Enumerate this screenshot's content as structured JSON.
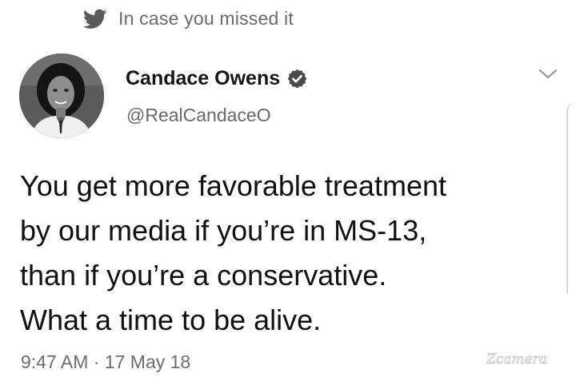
{
  "context": {
    "icon": "twitter-bird-icon",
    "text": "In case you missed it"
  },
  "author": {
    "avatar": "profile-avatar",
    "display_name": "Candace Owens",
    "verified_icon": "verified-badge-icon",
    "handle": "@RealCandaceO"
  },
  "tweet": {
    "lines": [
      "You get more favorable treatment",
      "by our media if you’re in MS-13,",
      "than if you’re a conservative.",
      "What a time to be alive."
    ],
    "timestamp": "9:47 AM · 17 May 18"
  },
  "menu": {
    "icon": "chevron-down-icon"
  },
  "watermark": {
    "text": "Zcamera"
  },
  "colors": {
    "verified": "#4a4a4a",
    "secondary_text": "#6b6b6b",
    "primary_text": "#111111"
  }
}
